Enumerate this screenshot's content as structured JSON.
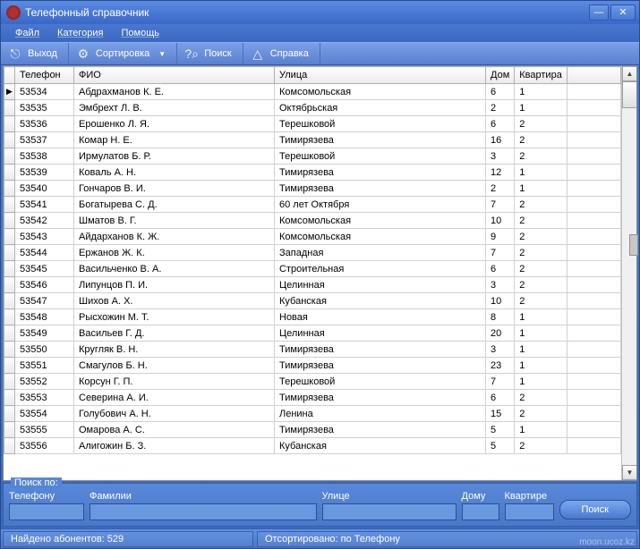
{
  "window": {
    "title": "Телефонный справочник"
  },
  "menu": {
    "file": "Файл",
    "category": "Категория",
    "help": "Помощь"
  },
  "toolbar": {
    "exit": "Выход",
    "sort": "Сортировка",
    "search": "Поиск",
    "help": "Справка"
  },
  "columns": {
    "phone": "Телефон",
    "fio": "ФИО",
    "street": "Улица",
    "house": "Дом",
    "flat": "Квартира"
  },
  "rows": [
    {
      "phone": "53534",
      "fio": "Абдрахманов К. Е.",
      "street": "Комсомольская",
      "house": "6",
      "flat": "1"
    },
    {
      "phone": "53535",
      "fio": "Эмбрехт Л. В.",
      "street": "Октябрьская",
      "house": "2",
      "flat": "1"
    },
    {
      "phone": "53536",
      "fio": "Ерошенко Л. Я.",
      "street": "Терешковой",
      "house": "6",
      "flat": "2"
    },
    {
      "phone": "53537",
      "fio": "Комар Н. Е.",
      "street": "Тимирязева",
      "house": "16",
      "flat": "2"
    },
    {
      "phone": "53538",
      "fio": "Ирмулатов Б. Р.",
      "street": "Терешковой",
      "house": "3",
      "flat": "2"
    },
    {
      "phone": "53539",
      "fio": "Коваль А. Н.",
      "street": "Тимирязева",
      "house": "12",
      "flat": "1"
    },
    {
      "phone": "53540",
      "fio": "Гончаров В. И.",
      "street": "Тимирязева",
      "house": "2",
      "flat": "1"
    },
    {
      "phone": "53541",
      "fio": "Богатырева С. Д.",
      "street": "60 лет Октября",
      "house": "7",
      "flat": "2"
    },
    {
      "phone": "53542",
      "fio": "Шматов В. Г.",
      "street": "Комсомольская",
      "house": "10",
      "flat": "2"
    },
    {
      "phone": "53543",
      "fio": "Айдарханов К. Ж.",
      "street": "Комсомольская",
      "house": "9",
      "flat": "2"
    },
    {
      "phone": "53544",
      "fio": "Ержанов Ж. К.",
      "street": "Западная",
      "house": "7",
      "flat": "2"
    },
    {
      "phone": "53545",
      "fio": "Васильченко В. А.",
      "street": "Строительная",
      "house": "6",
      "flat": "2"
    },
    {
      "phone": "53546",
      "fio": "Липунцов П. И.",
      "street": "Целинная",
      "house": "3",
      "flat": "2"
    },
    {
      "phone": "53547",
      "fio": "Шихов А. Х.",
      "street": "Кубанская",
      "house": "10",
      "flat": "2"
    },
    {
      "phone": "53548",
      "fio": "Рысхожин М. Т.",
      "street": "Новая",
      "house": "8",
      "flat": "1"
    },
    {
      "phone": "53549",
      "fio": "Васильев Г. Д.",
      "street": "Целинная",
      "house": "20",
      "flat": "1"
    },
    {
      "phone": "53550",
      "fio": "Кругляк В. Н.",
      "street": "Тимирязева",
      "house": "3",
      "flat": "1"
    },
    {
      "phone": "53551",
      "fio": "Смагулов Б. Н.",
      "street": "Тимирязева",
      "house": "23",
      "flat": "1"
    },
    {
      "phone": "53552",
      "fio": "Корсун Г. П.",
      "street": "Терешковой",
      "house": "7",
      "flat": "1"
    },
    {
      "phone": "53553",
      "fio": "Северина А. И.",
      "street": "Тимирязева",
      "house": "6",
      "flat": "2"
    },
    {
      "phone": "53554",
      "fio": "Голубович А. Н.",
      "street": "Ленина",
      "house": "15",
      "flat": "2"
    },
    {
      "phone": "53555",
      "fio": "Омарова А. С.",
      "street": "Тимирязева",
      "house": "5",
      "flat": "1"
    },
    {
      "phone": "53556",
      "fio": "Алигожин Б. З.",
      "street": "Кубанская",
      "house": "5",
      "flat": "2"
    }
  ],
  "search_panel": {
    "legend": "Поиск по:",
    "phone": "Телефону",
    "surname": "Фамилии",
    "street": "Улице",
    "house": "Дому",
    "flat": "Квартире",
    "button": "Поиск"
  },
  "status": {
    "found": "Найдено абонентов: 529",
    "sorted": "Отсортировано: по Телефону"
  },
  "watermark": "moon.ucoz.kz"
}
